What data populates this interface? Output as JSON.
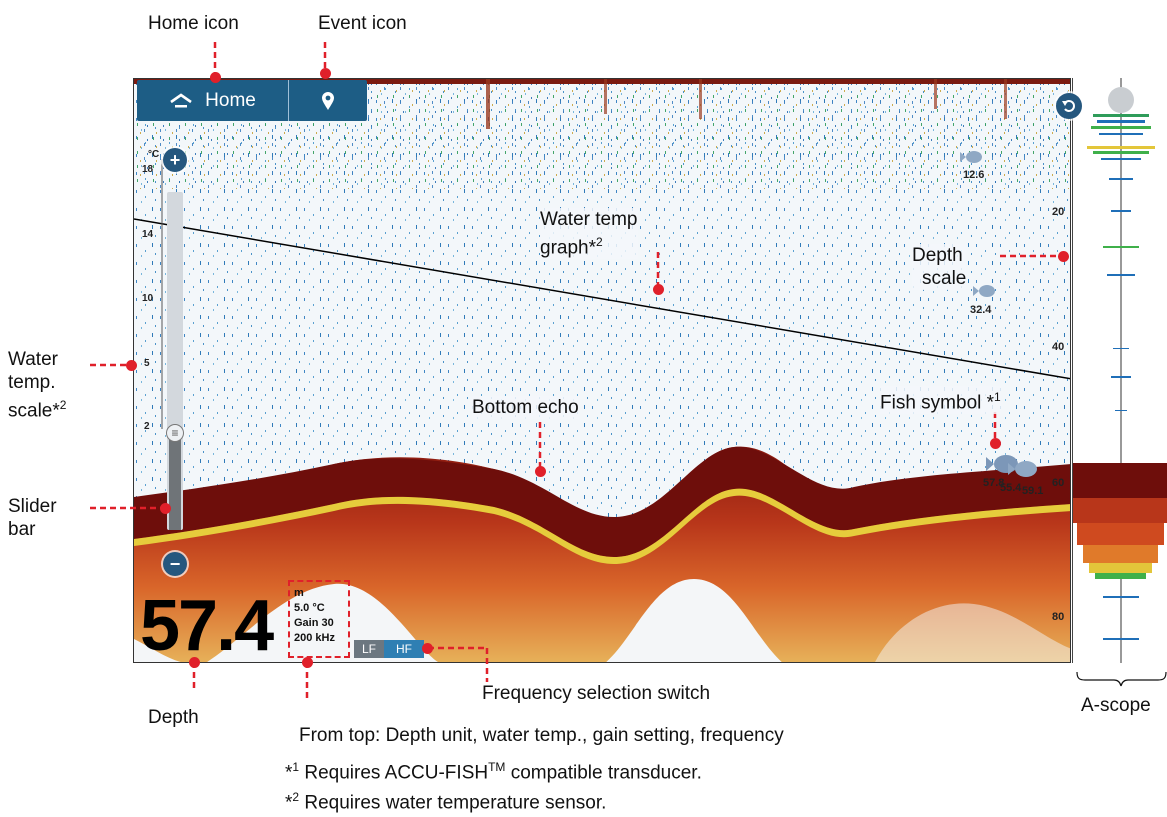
{
  "topbar": {
    "home_label": "Home"
  },
  "temp_scale": {
    "unit": "°C",
    "ticks": [
      "18",
      "14",
      "10",
      "5",
      "2"
    ]
  },
  "depth_scale": {
    "ticks": [
      "20",
      "40",
      "60",
      "80"
    ]
  },
  "fish": [
    "12.6",
    "32.4",
    "57.8",
    "55.4",
    "59.1"
  ],
  "readout": {
    "depth": "57.4",
    "unit": "m",
    "water_temp": "5.0 °C",
    "gain": "Gain 30",
    "frequency": "200 kHz"
  },
  "freq_switch": {
    "lf": "LF",
    "hf": "HF"
  },
  "callouts": {
    "home_icon": "Home icon",
    "event_icon": "Event icon",
    "water_temp_graph": "Water temp",
    "water_temp_graph_2": "graph*",
    "depth_scale": "Depth",
    "depth_scale_2": "scale",
    "water_temp_scale": "Water",
    "water_temp_scale_2": "temp.",
    "water_temp_scale_3": "scale*",
    "fish_symbol": "Fish symbol *",
    "bottom_echo": "Bottom echo",
    "slider_bar": "Slider",
    "slider_bar_2": "bar",
    "frequency_switch": "Frequency selection switch",
    "depth": "Depth",
    "a_scope": "A-scope",
    "from_top": "From top: Depth unit, water temp., gain setting, frequency",
    "note1_mark": "*",
    "note1_sup": "1",
    "note1_text": " Requires ACCU-FISH",
    "note1_tm": "TM",
    "note1_end": " compatible transducer.",
    "note2_mark": "*",
    "note2_sup": "2",
    "note2_text": " Requires water temperature sensor.",
    "sup1": "1",
    "sup2": "2"
  },
  "colors": {
    "bar_blue": "#1d5d85",
    "callout_red": "#e0202a",
    "echo_dark": "#6e0e0b"
  }
}
